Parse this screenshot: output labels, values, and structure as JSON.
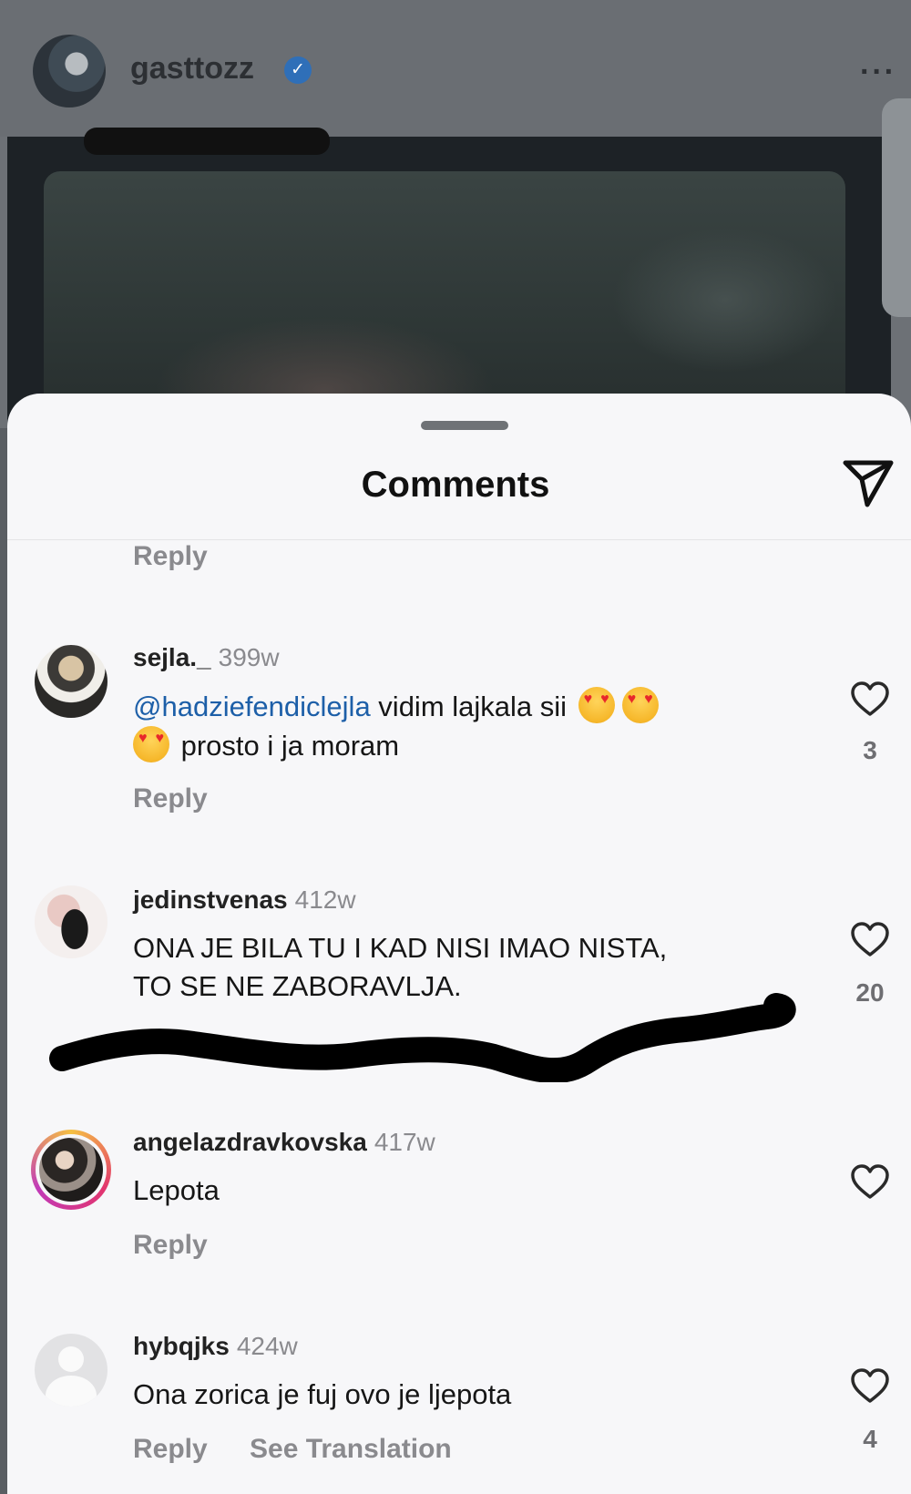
{
  "post": {
    "username": "gasttozz",
    "verified": true,
    "more_icon": "more-dots-icon"
  },
  "sheet": {
    "title": "Comments",
    "share_icon": "paper-plane-icon"
  },
  "top_reply_label": "Reply",
  "comments": [
    {
      "username": "sejla._",
      "time": "399w",
      "mention": "@hadziefendiclejla",
      "text_line1": " vidim lajkala sii ",
      "text_line2": " prosto i ja moram",
      "emoji": "heart-eyes-emoji",
      "likes": "3",
      "reply_label": "Reply"
    },
    {
      "username": "jedinstvenas",
      "time": "412w",
      "text_line1": "ONA JE BILA TU I KAD NISI IMAO NISTA,",
      "text_line2": "TO SE NE ZABORAVLJA.",
      "likes": "20"
    },
    {
      "username": "angelazdravkovska",
      "time": "417w",
      "text": "Lepota",
      "has_story_ring": true,
      "reply_label": "Reply"
    },
    {
      "username": "hybqjks",
      "time": "424w",
      "text": "Ona zorica je fuj ovo je ljepota",
      "likes": "4",
      "reply_label": "Reply",
      "translate_label": "See Translation"
    }
  ],
  "colors": {
    "mention": "#1d5fa8",
    "muted": "#8a8a8e",
    "sheet_bg": "#f7f7f9",
    "story_ring": "#d6338a"
  }
}
